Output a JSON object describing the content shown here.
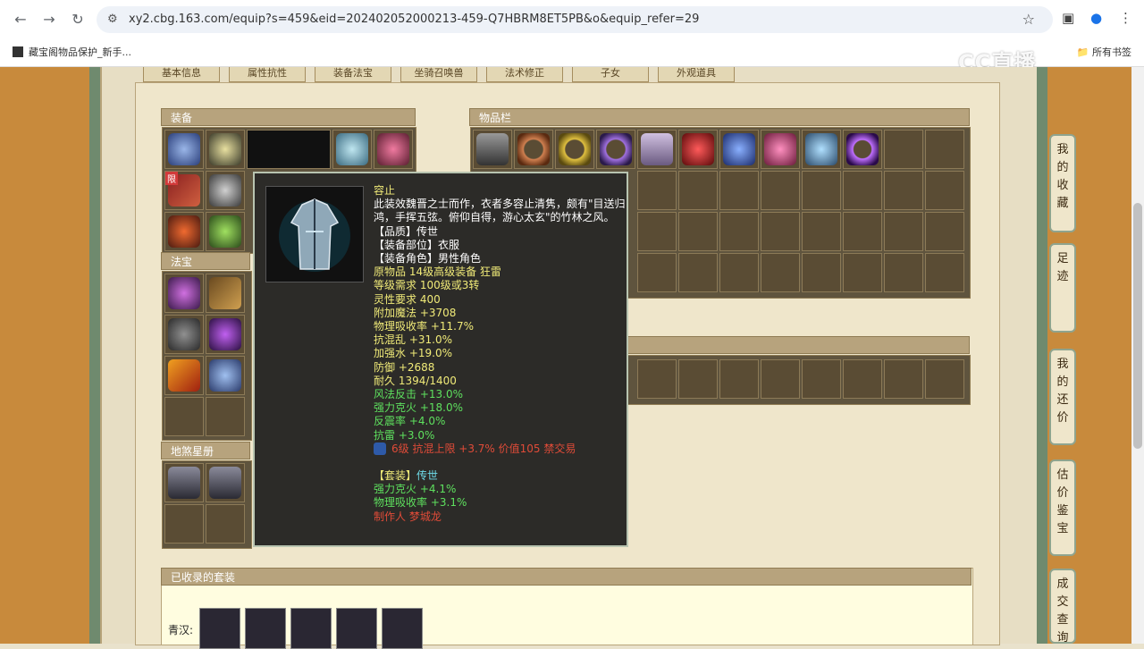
{
  "browser": {
    "url": "xy2.cbg.163.com/equip?s=459&eid=202402052000213-459-Q7HBRM8ET5PB&o&equip_refer=29",
    "bookmark": "藏宝阁物品保护_新手...",
    "bookmarks_all": "所有书签"
  },
  "watermark": "CC直播",
  "tabs": [
    "基本信息",
    "属性抗性",
    "装备法宝",
    "坐骑召唤兽",
    "法术修正",
    "子女",
    "外观道具"
  ],
  "panels": {
    "equip": "装备",
    "fabao": "法宝",
    "star": "地煞星册",
    "inventory": "物品栏",
    "collected_sets": "已收录的套装"
  },
  "badges": {
    "limit": "限"
  },
  "side_tabs": [
    "我的收藏",
    "足迹",
    "我的还价",
    "估价鉴宝",
    "成交查询"
  ],
  "tooltip": {
    "name": "容止",
    "desc": "此装效魏晋之士而作，衣者多容止清隽，颇有\"目送归鸿，手挥五弦。俯仰自得，游心太玄\"的竹林之风。",
    "quality": "【品质】传世",
    "slot": "【装备部位】衣服",
    "role": "【装备角色】男性角色",
    "origin": "原物品 14级高级装备 狂雷",
    "level_req": "等级需求 100级或3转",
    "spirit_req": "灵性要求 400",
    "magic": "附加魔法 +3708",
    "phys_absorb": "物理吸收率 +11.7%",
    "resist_chaos": "抗混乱 +31.0%",
    "water_boost": "加强水 +19.0%",
    "defense": "防御 +2688",
    "durability": "耐久 1394/1400",
    "wind_counter": "风法反击 +13.0%",
    "fire_overcome": "强力克火 +18.0%",
    "shock_rate": "反震率 +4.0%",
    "resist_thunder": "抗雷 +3.0%",
    "gem_line": "6级 抗混上限 +3.7% 价值105 禁交易",
    "set_label": "【套装】",
    "set_name": "传世",
    "set_fire": "强力克火 +4.1%",
    "set_absorb": "物理吸收率 +3.1%",
    "maker": "制作人 梦城龙"
  },
  "set_row_label": "青汉:",
  "colors": {
    "tt_yellow": "#f0ea78",
    "tt_white": "#ffffff",
    "tt_green": "#5ee05e",
    "tt_red": "#e04b38",
    "tt_cyan": "#6fdcea",
    "header_brown": "#b7a37d"
  },
  "item_icons": [
    "hat-icon",
    "sword-icon",
    "mask-icon",
    "necklace-icon",
    "weapon-icon",
    "belt-icon",
    "ring-icon",
    "shoe-icon"
  ]
}
